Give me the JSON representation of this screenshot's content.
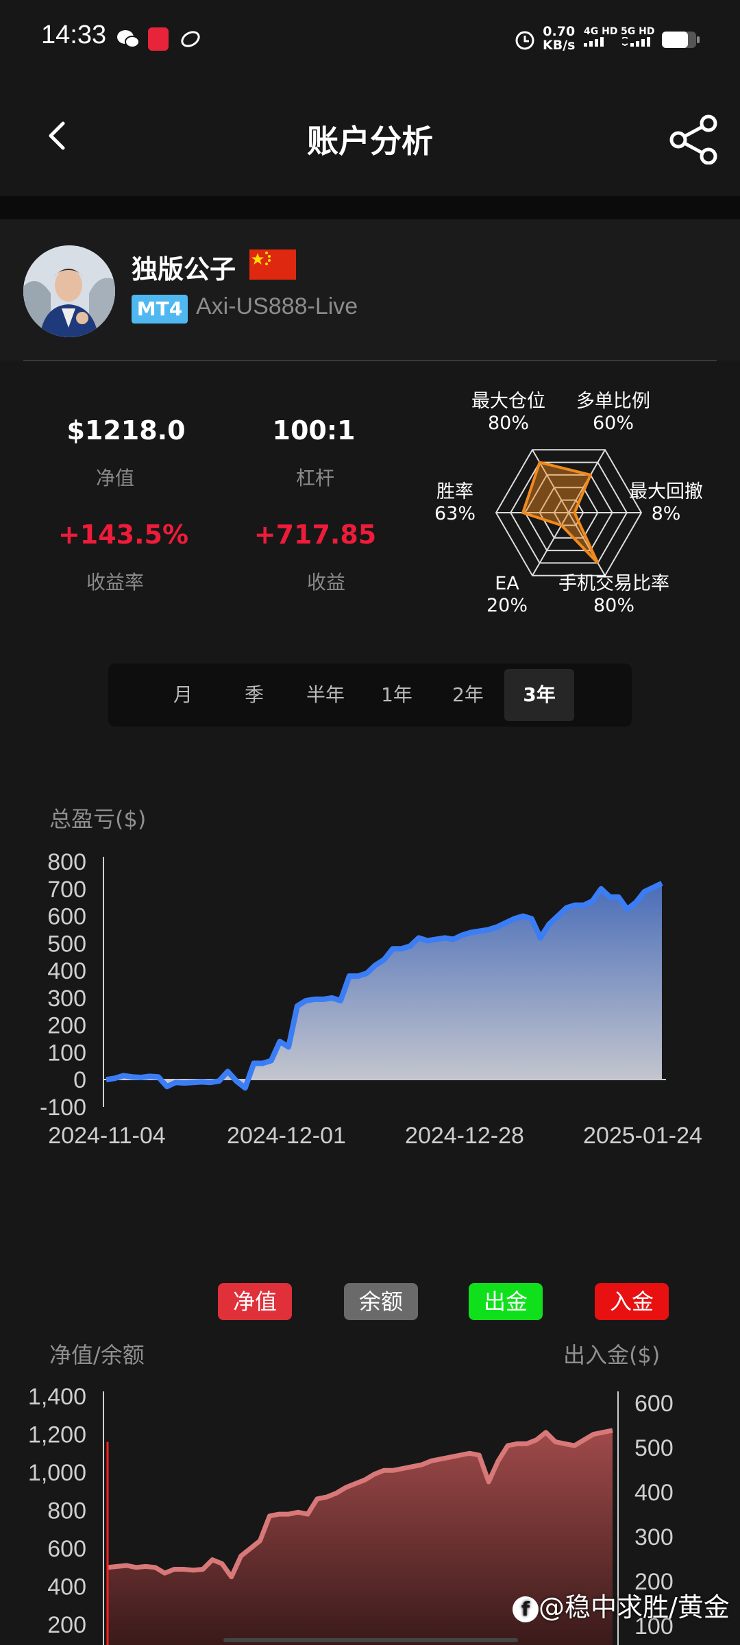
{
  "status_bar": {
    "time": "14:33",
    "speed_value": "0.70",
    "speed_unit": "KB/s",
    "signal1": "4G HD",
    "signal2": "5G HD"
  },
  "header": {
    "title": "账户分析",
    "back_icon": "chevron-left-icon",
    "share_icon": "share-icon"
  },
  "profile": {
    "name": "独版公子",
    "platform_badge": "MT4",
    "server": "Axi-US888-Live"
  },
  "stats": {
    "equity_value": "$1218.0",
    "equity_label": "净值",
    "leverage_value": "100:1",
    "leverage_label": "杠杆",
    "return_value": "+143.5%",
    "return_label": "收益率",
    "profit_value": "+717.85",
    "profit_label": "收益"
  },
  "radar": {
    "axes": [
      {
        "label": "最大仓位",
        "value_text": "80%",
        "value": 80
      },
      {
        "label": "多单比例",
        "value_text": "60%",
        "value": 60
      },
      {
        "label": "最大回撤",
        "value_text": "8%",
        "value": 8
      },
      {
        "label": "手机交易比率",
        "value_text": "80%",
        "value": 80
      },
      {
        "label": "EA",
        "value_text": "20%",
        "value": 20
      },
      {
        "label": "胜率",
        "value_text": "63%",
        "value": 63
      }
    ],
    "color": "#f08a1c"
  },
  "tabs": [
    {
      "label": "月",
      "active": false
    },
    {
      "label": "季",
      "active": false
    },
    {
      "label": "半年",
      "active": false
    },
    {
      "label": "1年",
      "active": false
    },
    {
      "label": "2年",
      "active": false
    },
    {
      "label": "3年",
      "active": true
    }
  ],
  "chart_data": [
    {
      "type": "area",
      "title": "",
      "ylabel": "总盈亏($)",
      "ylim": [
        -100,
        800
      ],
      "yticks": [
        "800",
        "700",
        "600",
        "500",
        "400",
        "300",
        "200",
        "100",
        "0",
        "-100"
      ],
      "x_ticks": [
        "2024-11-04",
        "2024-12-01",
        "2024-12-28",
        "2025-01-24"
      ],
      "series": [
        {
          "color": "#3b7df5",
          "values": [
            0,
            5,
            15,
            10,
            8,
            12,
            10,
            -25,
            -10,
            -12,
            -10,
            -8,
            -10,
            -5,
            30,
            -5,
            -30,
            60,
            60,
            70,
            140,
            120,
            270,
            290,
            295,
            295,
            300,
            290,
            380,
            380,
            390,
            420,
            440,
            480,
            480,
            490,
            520,
            510,
            515,
            520,
            515,
            530,
            540,
            545,
            550,
            560,
            575,
            590,
            600,
            590,
            520,
            570,
            600,
            630,
            640,
            640,
            655,
            700,
            670,
            670,
            625,
            650,
            690,
            705,
            720
          ]
        }
      ]
    },
    {
      "type": "area",
      "title": "",
      "ylabel": "净值/余额",
      "y2label": "出入金($)",
      "ylim": [
        200,
        1400
      ],
      "yticks": [
        "1,400",
        "1,200",
        "1,000",
        "800",
        "600",
        "400",
        "200"
      ],
      "y2ticks": [
        "600",
        "500",
        "400",
        "300",
        "200",
        "100"
      ],
      "legend": [
        {
          "label": "净值",
          "color": "#e0303a"
        },
        {
          "label": "余额",
          "color": "#6a6a6a"
        },
        {
          "label": "出金",
          "color": "#10e01c"
        },
        {
          "label": "入金",
          "color": "#e81010"
        }
      ],
      "series": [
        {
          "name": "净值",
          "color": "#d46a6a",
          "values": [
            500,
            505,
            510,
            500,
            505,
            500,
            470,
            490,
            490,
            485,
            490,
            540,
            520,
            450,
            560,
            600,
            640,
            770,
            780,
            780,
            790,
            780,
            860,
            870,
            890,
            920,
            940,
            960,
            990,
            1010,
            1010,
            1020,
            1030,
            1040,
            1060,
            1070,
            1080,
            1090,
            1100,
            1090,
            950,
            1060,
            1140,
            1150,
            1150,
            1170,
            1210,
            1160,
            1150,
            1140,
            1170,
            1200,
            1210,
            1220
          ]
        }
      ],
      "deposit_marker": {
        "value": 1160
      }
    }
  ],
  "watermark": "@稳中求胜/黄金"
}
